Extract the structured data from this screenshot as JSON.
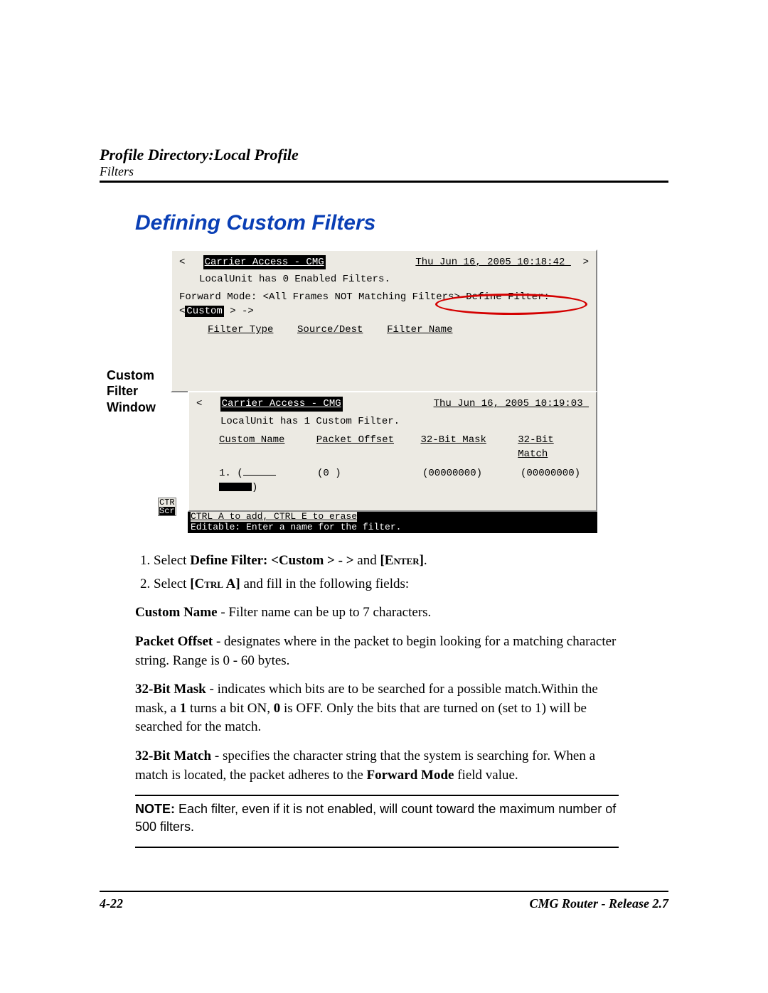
{
  "header": {
    "breadcrumb": "Profile Directory:Local Profile",
    "sub": "Filters"
  },
  "section_title": "Defining Custom Filters",
  "side_label": "Custom Filter Window",
  "term1": {
    "title": "Carrier Access - CMG",
    "timestamp": "Thu Jun 16, 2005 10:18:42_",
    "line2": "LocalUnit has 0 Enabled Filters.",
    "fwd_label": "Forward Mode:",
    "fwd_value": "<All Frames NOT Matching Filters>",
    "def_label": "Define Filter:",
    "def_value": "Custom",
    "col1": "Filter Type",
    "col2": "Source/Dest",
    "col3": "Filter Name"
  },
  "term2": {
    "title": "Carrier Access - CMG",
    "timestamp": "Thu Jun 16, 2005 10:19:03_",
    "line2": "LocalUnit has 1 Custom Filter.",
    "col1": "Custom Name",
    "col2": "Packet Offset",
    "col3": "32-Bit Mask",
    "col4": "32-Bit Match",
    "row_idx": "1.",
    "row_name_open": "(",
    "row_name_close": ")",
    "row_offset": "(0 )",
    "row_mask": "(00000000)",
    "row_match": "(00000000)",
    "status1": "CTRL A to add,  CTRL E to erase",
    "status2": "Editable: Enter a name for the filter.",
    "tab1": "CTR",
    "tab2": "Scr"
  },
  "body": {
    "li1_a": "Select ",
    "li1_b": "Define Filter: <Custom > - >",
    "li1_c": " and ",
    "li1_d": "[Enter]",
    "li1_e": ".",
    "li2_a": "Select ",
    "li2_b": "[Ctrl A]",
    "li2_c": " and fill in the following fields:",
    "p1_b": "Custom Name",
    "p1_t": " - Filter name can be up to 7 characters.",
    "p2_b": "Packet Offset",
    "p2_t": " - designates where in the packet to begin looking for a matching character string. Range is 0 - 60 bytes.",
    "p3_b": "32-Bit Mask",
    "p3_t1": " - indicates which bits are to be searched for a possible match.Within the mask, a ",
    "p3_b2": "1",
    "p3_t2": " turns a bit ON, ",
    "p3_b3": "0",
    "p3_t3": " is OFF. Only the bits that are turned on (set to 1) will be searched for the match.",
    "p4_b": "32-Bit Match",
    "p4_t1": " - specifies the character string that the system is searching for. When a match is located, the packet adheres to the ",
    "p4_b2": "Forward Mode",
    "p4_t2": " field value.",
    "note_b": "NOTE:",
    "note_t": "  Each filter, even if it is not enabled, will count toward the maximum number of 500 filters."
  },
  "footer": {
    "page": "4-22",
    "doc": "CMG Router - Release 2.7"
  }
}
